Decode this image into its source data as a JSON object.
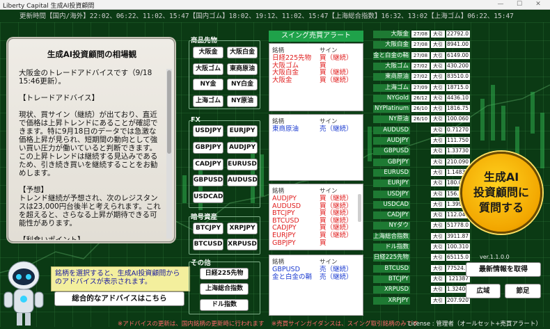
{
  "window": {
    "title": "Liberty Capital 生成AI投資顧問",
    "min": "—",
    "max": "☐",
    "close": "✕"
  },
  "update_bar": "更新時間【国内/海外】22:02、06:22、11:02、15:47【国内ゴム】18:02、19:12、11:02、15:47【上海総合指数】16:32、13:02【上海ゴム】06:22、15:47",
  "advisor": {
    "title": "生成AI投資顧問の相場観",
    "text": "大阪金のトレードアドバイスです（9/18 15:46更新）。\n\n【トレードアドバイス】\n\n現状、買サイン（継続）が出ており、直近で価格は上昇トレンドにあることが確認できます。特に9月18日のデータでは急激な価格上昇が見られ、短期間の動向として強い買い圧力が働いていると判断できます。この上昇トレンドは継続する見込みであるため、引き続き買いを継続することをお勧めします。\n\n【予想】\nトレンド継続が予想され、次のレジスタンスは23,000円台後半と考えられます。これを超えると、さらなる上昇が期待できる可能性があります。\n\n【利食いポイント】"
  },
  "advice_box": "銘柄を選択すると、生成AI投資顧問からのアドバイスが表示されます。",
  "overall_button": "総合的なアドバイスはこちら",
  "sections": {
    "commodities_label": "商品先物",
    "commodities": [
      "大阪金",
      "大阪白金",
      "大阪ゴム",
      "東商原油",
      "NY金",
      "NY白金",
      "上海ゴム",
      "NY原油"
    ],
    "fx_label": "FX",
    "fx": [
      "USDJPY",
      "EURJPY",
      "GBPJPY",
      "AUDJPY",
      "CADJPY",
      "EURUSD",
      "GBPUSD",
      "AUDUSD",
      "USDCAD"
    ],
    "crypto_label": "暗号資産",
    "crypto": [
      "BTCJPY",
      "XRPJPY",
      "BTCUSD",
      "XRPUSD"
    ],
    "other_label": "その他",
    "other": [
      "日経225先物",
      "上海総合指数",
      "ドル指数"
    ]
  },
  "swing": {
    "header": "スイング売買アラート",
    "col_name": "銘柄",
    "col_sign": "サイン",
    "panel1": [
      {
        "name": "日経225先物",
        "sign": "買（継続）",
        "type": "buy"
      },
      {
        "name": "大阪ゴム",
        "sign": "買",
        "type": "buy"
      },
      {
        "name": "大阪白金",
        "sign": "買（継続）",
        "type": "buy"
      },
      {
        "name": "大阪金",
        "sign": "買（継続）",
        "type": "buy"
      }
    ],
    "panel2": [
      {
        "name": "東商原油",
        "sign": "売（継続）",
        "type": "sell"
      }
    ],
    "panel3": [
      {
        "name": "AUDJPY",
        "sign": "買（継続）",
        "type": "buy"
      },
      {
        "name": "AUDUSD",
        "sign": "買（継続）",
        "type": "buy"
      },
      {
        "name": "BTCJPY",
        "sign": "買（継続）",
        "type": "buy"
      },
      {
        "name": "BTCUSD",
        "sign": "買（継続）",
        "type": "buy"
      },
      {
        "name": "CADJPY",
        "sign": "買（継続）",
        "type": "buy"
      },
      {
        "name": "EURJPY",
        "sign": "買（継続）",
        "type": "buy"
      },
      {
        "name": "GBPJPY",
        "sign": "買",
        "type": "buy"
      }
    ],
    "panel4": [
      {
        "name": "GBPUSD",
        "sign": "売（継続）",
        "type": "sell"
      },
      {
        "name": "金と白金の鞘",
        "sign": "売（継続）",
        "type": "sell"
      }
    ]
  },
  "prices": [
    {
      "label": "大阪金",
      "date": "27/08",
      "tag": "大引",
      "value": "22792.0"
    },
    {
      "label": "大阪白金",
      "date": "27/08",
      "tag": "大引",
      "value": "8941.00"
    },
    {
      "label": "金と白金の鞘",
      "date": "27/08",
      "tag": "大引",
      "value": "6149.00"
    },
    {
      "label": "大阪ゴム",
      "date": "27/02",
      "tag": "大引",
      "value": "430.200"
    },
    {
      "label": "東商原油",
      "date": "27/02",
      "tag": "大引",
      "value": "83510.0"
    },
    {
      "label": "上海ゴム",
      "date": "27/09",
      "tag": "大引",
      "value": "18715.0"
    },
    {
      "label": "NYGold",
      "date": "26/12",
      "tag": "大引",
      "value": "4436.10"
    },
    {
      "label": "NYPlatinum",
      "date": "26/10",
      "tag": "大引",
      "value": "1816.75"
    },
    {
      "label": "NY原油",
      "date": "26/10",
      "tag": "大引",
      "value": "100.060"
    },
    {
      "label": "AUDUSD",
      "date": "",
      "tag": "大引",
      "value": "0.71270"
    },
    {
      "label": "AUDJPY",
      "date": "",
      "tag": "大引",
      "value": "111.750"
    },
    {
      "label": "GBPUSD",
      "date": "",
      "tag": "大引",
      "value": "1.33730"
    },
    {
      "label": "GBPJPY",
      "date": "",
      "tag": "大引",
      "value": "210.090"
    },
    {
      "label": "EURUSD",
      "date": "",
      "tag": "大引",
      "value": "1.14830"
    },
    {
      "label": "EURJPY",
      "date": "",
      "tag": "大引",
      "value": "180.070"
    },
    {
      "label": "USDJPY",
      "date": "",
      "tag": "大引",
      "value": "156.760"
    },
    {
      "label": "USDCAD",
      "date": "",
      "tag": "大引",
      "value": "1.39970"
    },
    {
      "label": "CADJPY",
      "date": "",
      "tag": "大引",
      "value": "112.040"
    },
    {
      "label": "NYダウ",
      "date": "",
      "tag": "大引",
      "value": "51778.0"
    },
    {
      "label": "上海総合指数",
      "date": "",
      "tag": "大引",
      "value": "3911.87"
    },
    {
      "label": "ドル指数",
      "date": "",
      "tag": "大引",
      "value": "100.310"
    },
    {
      "label": "日経225先物",
      "date": "",
      "tag": "大引",
      "value": "65115.0"
    },
    {
      "label": "BTCUSD",
      "date": "",
      "tag": "大引",
      "value": "77524.7"
    },
    {
      "label": "BTCJPY",
      "date": "",
      "tag": "大引",
      "value": "121387"
    },
    {
      "label": "XRPUSD",
      "date": "",
      "tag": "大引",
      "value": "1.32400"
    },
    {
      "label": "XRPJPY",
      "date": "",
      "tag": "大引",
      "value": "207.920"
    }
  ],
  "badge": [
    "生成AI",
    "投資顧問に",
    "質問する"
  ],
  "version": "ver.1.1.0.0",
  "latest_button": "最新情報を取得",
  "wide_button": "広域",
  "close_button": "節足",
  "footer": {
    "left": "※アドバイスの更新は、国内銘柄の更新時に行われます",
    "mid": "※売買サインガイダンスは、スイング取引銘柄のみです",
    "license": "License : 管理者（オールセット+売買アラート）"
  }
}
